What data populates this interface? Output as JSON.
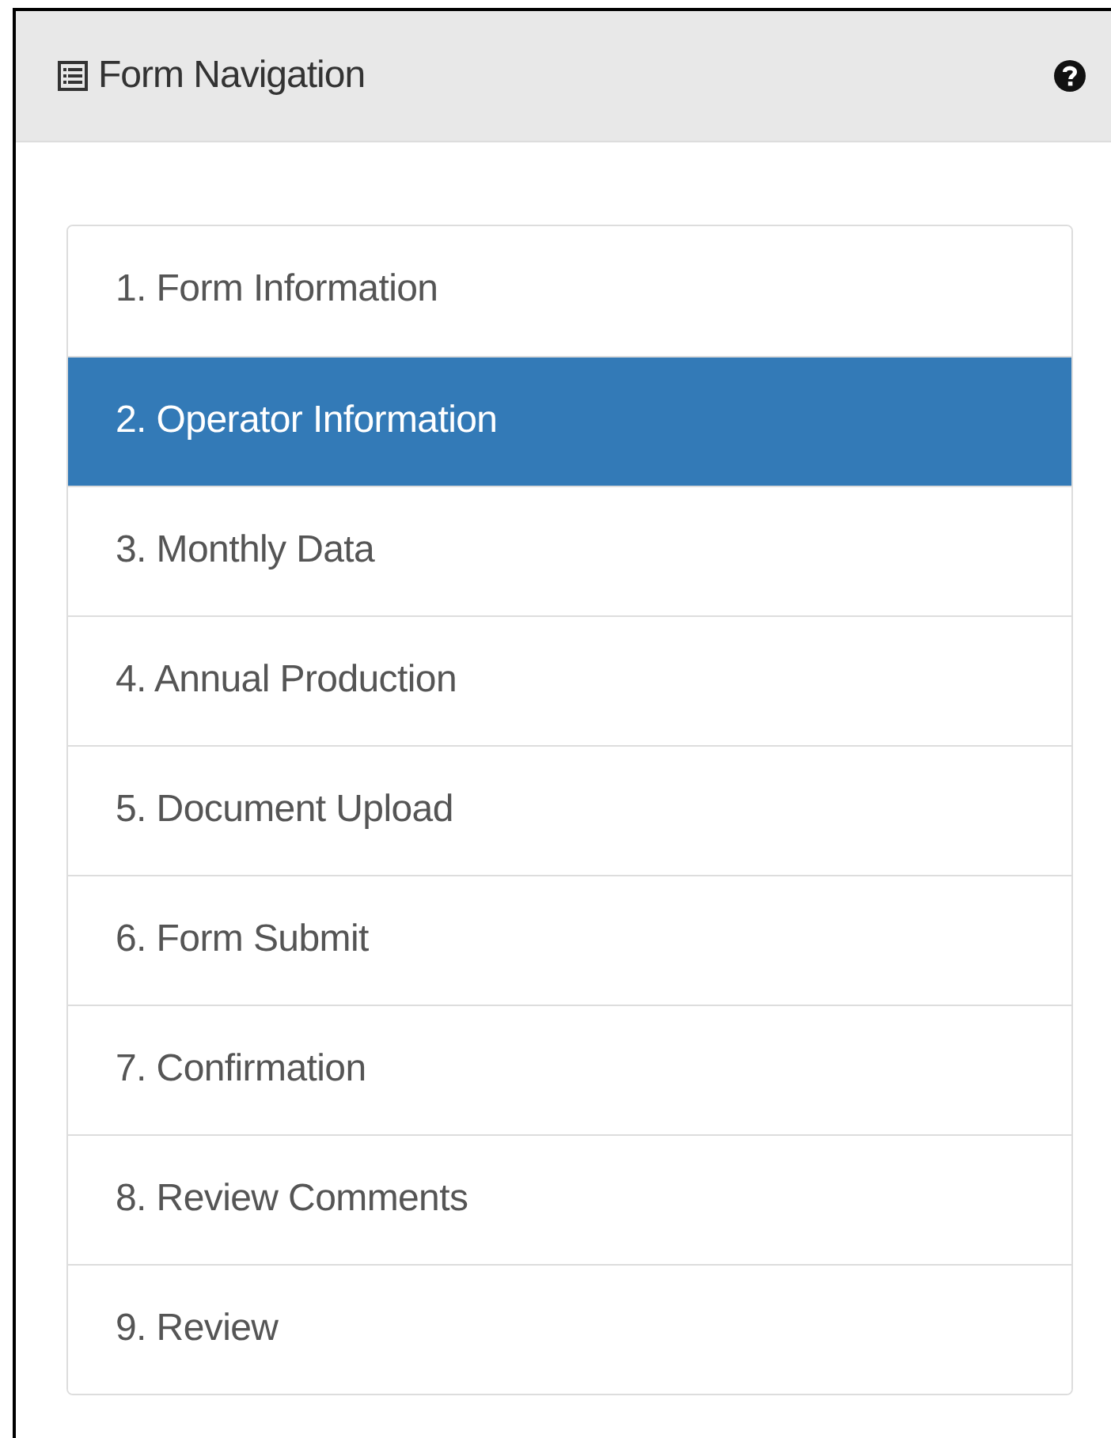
{
  "panel": {
    "title": "Form Navigation"
  },
  "nav_items": [
    {
      "label": "1. Form Information",
      "selected": false
    },
    {
      "label": "2. Operator Information",
      "selected": true
    },
    {
      "label": "3. Monthly Data",
      "selected": false
    },
    {
      "label": "4. Annual Production",
      "selected": false
    },
    {
      "label": "5. Document Upload",
      "selected": false
    },
    {
      "label": "6. Form Submit",
      "selected": false
    },
    {
      "label": "7. Confirmation",
      "selected": false
    },
    {
      "label": "8. Review Comments",
      "selected": false
    },
    {
      "label": "9. Review",
      "selected": false
    }
  ]
}
